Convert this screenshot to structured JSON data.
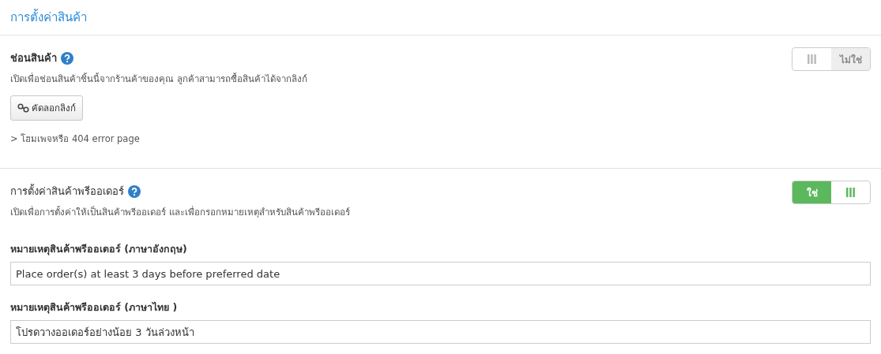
{
  "header": {
    "title": "การตั้งค่าสินค้า"
  },
  "sections": [
    {
      "title": "ช่อนสินค้า",
      "title_bold": true,
      "description": "เปิดเพื่อช่อนสินค้าชิ้นนี้จากร้านค้าของคุณ ลูกค้าสามารถซื้อสินค้าได้จากลิงก์",
      "toggle": {
        "on": false,
        "label": "ไม่ใช่"
      },
      "button": "คัดลอกลิงก์",
      "note": "> โฮมเพจหรือ 404 error page"
    },
    {
      "title": "การตั้งค่าสินค้าพรีออเดอร์",
      "title_bold": false,
      "description": "เปิดเพื่อการตั้งค่าให้เป็นสินค้าพรีออเดอร์ และเพื่อกรอกหมายเหตุสำหรับสินค้าพรีออเดอร์",
      "toggle": {
        "on": true,
        "label": "ใช่"
      },
      "fields": [
        {
          "label": "หมายเหตุสินค้าพรีออเดอร์ (ภาษาอังกฤษ)",
          "value": "Place order(s) at least 3 days before preferred date"
        },
        {
          "label": "หมายเหตุสินค้าพรีออเดอร์ (ภาษาไทย )",
          "value": "โปรดวางออเดอร์อย่างน้อย 3 วันล่วงหน้า"
        }
      ]
    }
  ]
}
